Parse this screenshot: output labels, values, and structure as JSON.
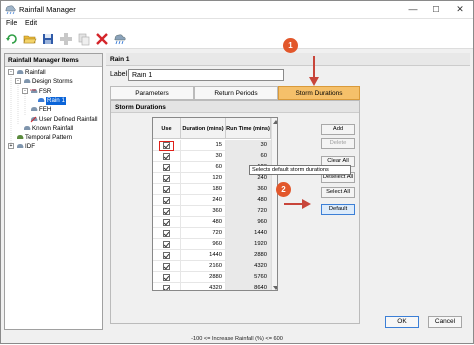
{
  "window": {
    "title": "Rainfall Manager"
  },
  "menu": [
    "File",
    "Edit"
  ],
  "toolbar": {
    "icons": [
      "refresh-icon",
      "open-folder-icon",
      "save-icon",
      "add-icon",
      "copy-icon",
      "delete-icon",
      "import-icon"
    ]
  },
  "left_panel": {
    "header": "Rainfall Manager Items",
    "tree": [
      {
        "label": "Rainfall",
        "level": 0,
        "expander": "-"
      },
      {
        "label": "Design Storms",
        "level": 1,
        "expander": "-"
      },
      {
        "label": "FSR",
        "level": 2,
        "expander": "-"
      },
      {
        "label": "Rain 1",
        "level": 3,
        "expander": "",
        "selected": true
      },
      {
        "label": "FEH",
        "level": 2,
        "expander": ""
      },
      {
        "label": "User Defined Rainfall",
        "level": 2,
        "expander": ""
      },
      {
        "label": "Known Rainfall",
        "level": 1,
        "expander": ""
      },
      {
        "label": "Temporal Pattern",
        "level": 0,
        "expander": ""
      },
      {
        "label": "IDF",
        "level": 0,
        "expander": "+"
      }
    ]
  },
  "right_panel": {
    "header": "Rain 1",
    "label_caption": "Label",
    "label_value": "Rain 1",
    "tabs": [
      "Parameters",
      "Return Periods",
      "Storm Durations"
    ],
    "active_tab": "Storm Durations",
    "section_title": "Storm Durations",
    "grid": {
      "columns": [
        "Use",
        "Duration (mins)",
        "Run Time (mins)"
      ],
      "rows": [
        {
          "use": true,
          "duration": "15",
          "run_time": "30"
        },
        {
          "use": true,
          "duration": "30",
          "run_time": "60"
        },
        {
          "use": true,
          "duration": "60",
          "run_time": "120"
        },
        {
          "use": true,
          "duration": "120",
          "run_time": "240"
        },
        {
          "use": true,
          "duration": "180",
          "run_time": "360"
        },
        {
          "use": true,
          "duration": "240",
          "run_time": "480"
        },
        {
          "use": true,
          "duration": "360",
          "run_time": "720"
        },
        {
          "use": true,
          "duration": "480",
          "run_time": "960"
        },
        {
          "use": true,
          "duration": "720",
          "run_time": "1440"
        },
        {
          "use": true,
          "duration": "960",
          "run_time": "1920"
        },
        {
          "use": true,
          "duration": "1440",
          "run_time": "2880"
        },
        {
          "use": true,
          "duration": "2160",
          "run_time": "4320"
        },
        {
          "use": true,
          "duration": "2880",
          "run_time": "5760"
        },
        {
          "use": true,
          "duration": "4320",
          "run_time": "8640"
        }
      ]
    },
    "side_buttons": [
      {
        "label": "Add",
        "disabled": false
      },
      {
        "label": "Delete",
        "disabled": true
      },
      {
        "label": "Clear All",
        "disabled": false
      },
      {
        "label": "Deselect All",
        "disabled": false
      },
      {
        "label": "Select All",
        "disabled": false
      },
      {
        "label": "Default",
        "disabled": false,
        "hover": true
      }
    ],
    "tooltip": "Selects default storm durations"
  },
  "callouts": [
    "1",
    "2"
  ],
  "footer": {
    "status": "-100 <= Increase Rainfall (%) <= 600",
    "ok": "OK",
    "cancel": "Cancel"
  },
  "colors": {
    "active_tab": "#f5c06a",
    "callout": "#e2572b",
    "selection": "#0a64d8"
  }
}
